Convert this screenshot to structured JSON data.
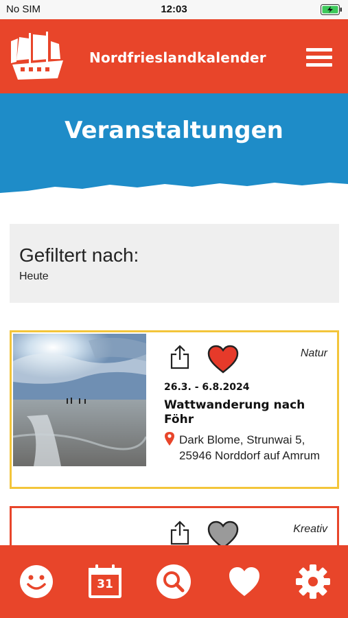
{
  "status_bar": {
    "carrier": "No SIM",
    "time": "12:03"
  },
  "header": {
    "app_title": "Nordfrieslandkalender"
  },
  "page": {
    "title": "Veranstaltungen"
  },
  "filter": {
    "label": "Gefiltert nach:",
    "value": "Heute"
  },
  "events": [
    {
      "category": "Natur",
      "date": "26.3. - 6.8.2024",
      "title": "Wattwanderung nach Föhr",
      "address": "Dark  Blome, Strunwai 5, 25946 Norddorf auf Amrum",
      "favorite": true,
      "border_color": "#f3c53a"
    },
    {
      "category": "Kreativ",
      "favorite": false,
      "border_color": "#e8452a"
    }
  ],
  "bottom_nav": {
    "items": [
      "smiley-icon",
      "calendar-icon",
      "search-icon",
      "heart-icon",
      "gear-icon"
    ],
    "calendar_day": "31"
  },
  "colors": {
    "brand_red": "#e8452a",
    "banner_blue": "#1e8cc8",
    "favorite_red": "#e63a2a",
    "inactive_gray": "#9a9a9a"
  }
}
